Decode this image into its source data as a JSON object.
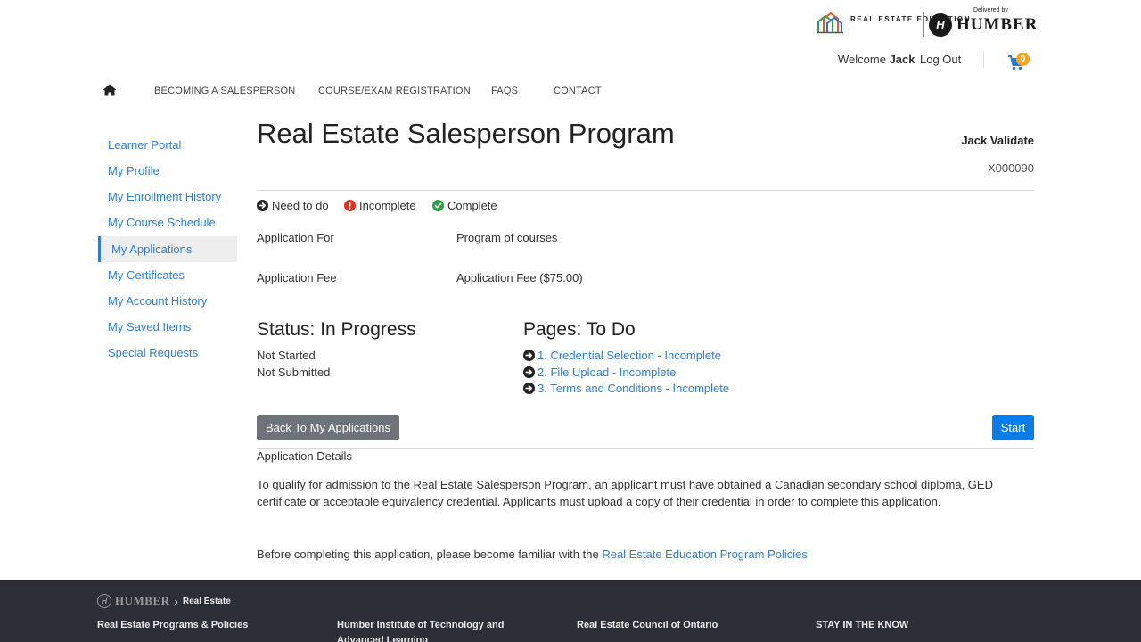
{
  "header": {
    "brand_left": "REAL ESTATE EDUCATION",
    "delivered_by": "Delivered by",
    "brand_right": "HUMBER",
    "welcome_prefix": "Welcome",
    "user_first_name": "Jack",
    "logout_label": "Log Out",
    "cart_count": "0"
  },
  "nav": {
    "items": [
      {
        "label": "BECOMING A SALESPERSON"
      },
      {
        "label": "COURSE/EXAM REGISTRATION"
      },
      {
        "label": "FAQS"
      },
      {
        "label": "CONTACT"
      }
    ]
  },
  "sidebar": {
    "active_index": 4,
    "items": [
      {
        "label": "Learner Portal"
      },
      {
        "label": "My Profile"
      },
      {
        "label": "My Enrollment History"
      },
      {
        "label": "My Course Schedule"
      },
      {
        "label": "My Applications"
      },
      {
        "label": "My Certificates"
      },
      {
        "label": "My Account History"
      },
      {
        "label": "My Saved Items"
      },
      {
        "label": "Special Requests"
      }
    ]
  },
  "main": {
    "title": "Real Estate Salesperson Program",
    "user_full_name": "Jack Validate",
    "user_id": "X000090",
    "legend": {
      "need_to_do": "Need to do",
      "incomplete": "Incomplete",
      "complete": "Complete"
    },
    "fields": [
      {
        "label": "Application For",
        "value": "Program of courses"
      },
      {
        "label": "Application Fee",
        "value": "Application Fee ($75.00)"
      }
    ],
    "status": {
      "heading": "Status: In Progress",
      "lines": [
        "Not Started",
        "Not Submitted"
      ]
    },
    "pages": {
      "heading": "Pages: To Do",
      "items": [
        {
          "label": "1. Credential Selection - Incomplete"
        },
        {
          "label": "2. File Upload - Incomplete"
        },
        {
          "label": "3. Terms and Conditions - Incomplete"
        }
      ]
    },
    "back_button": "Back To My Applications",
    "start_button": "Start",
    "details_heading": "Application Details",
    "details_text": "To qualify for admission to the Real Estate Salesperson Program, an applicant must have obtained a Canadian secondary school diploma, GED certificate or acceptable equivalency credential. Applicants must upload a copy of their credential in order to complete this application.",
    "policy_prefix": "Before completing this application, please become familiar with the",
    "policy_link": "Real Estate Education Program Policies"
  },
  "footer": {
    "brand": "HUMBER",
    "brand_sub": "Real Estate",
    "columns": [
      {
        "label": "Real Estate Programs & Policies"
      },
      {
        "label": "Humber Institute of Technology and Advanced Learning"
      },
      {
        "label": "Real Estate Council of Ontario"
      },
      {
        "label": "STAY IN THE KNOW"
      }
    ]
  },
  "colors": {
    "link": "#2f7fd0",
    "primary_button": "#0b7ce6",
    "secondary_button": "#6c737a",
    "incomplete": "#e0301e",
    "complete": "#2ea043",
    "footer_bg": "#2c2f36",
    "cart_badge": "#f6a623"
  }
}
